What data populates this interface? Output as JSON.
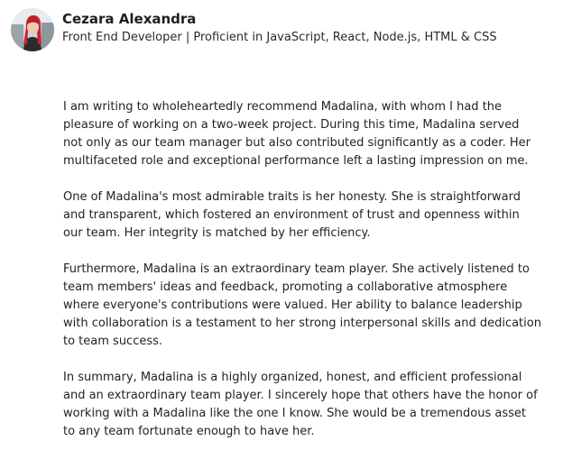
{
  "author": {
    "name": "Cezara Alexandra",
    "headline": "Front End Developer | Proficient in JavaScript, React, Node.js, HTML & CSS"
  },
  "recommendation": {
    "paragraphs": [
      "I am writing to wholeheartedly recommend Madalina, with whom I had the\npleasure of working on a two-week project. During this time, Madalina served\nnot only as our team manager but also contributed significantly as a coder. Her\nmultifaceted role and exceptional performance left a lasting impression on me.",
      "One of Madalina's most admirable traits is her honesty. She is straightforward\nand transparent, which fostered an environment of trust and openness within\nour team. Her integrity is matched by her efficiency.",
      "Furthermore, Madalina is an extraordinary team player. She actively listened to\nteam members' ideas and feedback, promoting a collaborative atmosphere\nwhere everyone's contributions were valued. Her ability to balance leadership\nwith collaboration is a testament to her strong interpersonal skills and dedication\nto team success.",
      "In summary, Madalina is a highly organized, honest, and efficient professional\nand an extraordinary team player. I sincerely hope that others have the honor of\nworking with a Madalina like the one I know. She would be a tremendous asset\nto any team fortunate enough to have her."
    ]
  }
}
